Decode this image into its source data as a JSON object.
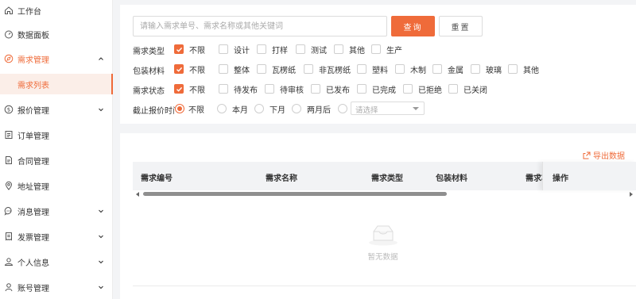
{
  "sidebar": {
    "items": [
      {
        "label": "工作台",
        "icon": "home-icon"
      },
      {
        "label": "数据面板",
        "icon": "dashboard-icon"
      },
      {
        "label": "需求管理",
        "icon": "compass-icon",
        "active": true,
        "expanded": true
      },
      {
        "label": "报价管理",
        "icon": "quote-icon",
        "expandable": true
      },
      {
        "label": "订单管理",
        "icon": "order-icon"
      },
      {
        "label": "合同管理",
        "icon": "contract-icon"
      },
      {
        "label": "地址管理",
        "icon": "location-icon"
      },
      {
        "label": "消息管理",
        "icon": "message-icon",
        "expandable": true
      },
      {
        "label": "发票管理",
        "icon": "invoice-icon",
        "expandable": true
      },
      {
        "label": "个人信息",
        "icon": "user-group-icon",
        "expandable": true
      },
      {
        "label": "账号管理",
        "icon": "user-icon",
        "expandable": true
      }
    ],
    "sub_item": "需求列表"
  },
  "search": {
    "placeholder": "请输入需求单号、需求名称或其他关键词",
    "value": "",
    "query_label": "查询",
    "reset_label": "重置"
  },
  "filters": {
    "type": {
      "label": "需求类型",
      "options": [
        "不限",
        "设计",
        "打样",
        "测试",
        "其他",
        "生产"
      ],
      "checked": [
        0
      ]
    },
    "material": {
      "label": "包装材料",
      "options": [
        "不限",
        "整体",
        "瓦楞纸",
        "非瓦楞纸",
        "塑料",
        "木制",
        "金属",
        "玻璃",
        "其他"
      ],
      "checked": [
        0
      ]
    },
    "status": {
      "label": "需求状态",
      "options": [
        "不限",
        "待发布",
        "待审核",
        "已发布",
        "已完成",
        "已拒绝",
        "已关闭"
      ],
      "checked": [
        0
      ]
    },
    "deadline": {
      "label": "截止报价时间",
      "options": [
        "不限",
        "本月",
        "下月",
        "两月后"
      ],
      "selected": 0,
      "select_placeholder": "请选择"
    }
  },
  "table": {
    "export_label": "导出数据",
    "columns": [
      "需求编号",
      "需求名称",
      "需求类型",
      "包装材料",
      "需求状态"
    ],
    "action_column": "操作",
    "empty_text": "暂无数据",
    "rows": []
  },
  "colors": {
    "accent": "#ef6b3a",
    "active_bg": "#fbeee8",
    "header_bg": "#f2f3f5"
  }
}
